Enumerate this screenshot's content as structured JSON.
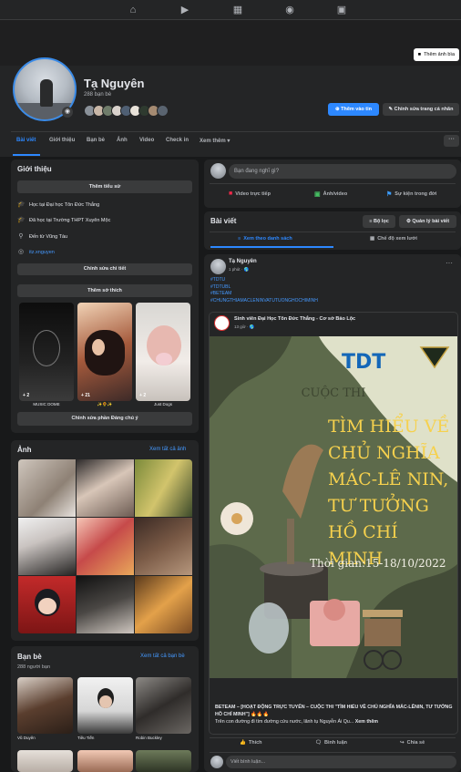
{
  "nav": {
    "icons": [
      "home-icon",
      "video-icon",
      "marketplace-icon",
      "groups-icon",
      "gaming-icon"
    ]
  },
  "cover": {
    "add_cover_label": "Thêm ảnh bìa"
  },
  "profile": {
    "name": "Tạ Nguyên",
    "friend_count": "288 bạn bè",
    "add_story_label": "Thêm vào tin",
    "edit_profile_label": "Chỉnh sửa trang cá nhân"
  },
  "tabs": [
    "Bài viết",
    "Giới thiệu",
    "Bạn bè",
    "Ảnh",
    "Video",
    "Check in",
    "Xem thêm"
  ],
  "intro": {
    "title": "Giới thiệu",
    "add_bio_label": "Thêm tiểu sử",
    "rows": [
      "Học tại Đại học Tôn Đức Thắng",
      "Đã học tại Trường THPT Xuyên Mộc",
      "Đến từ Vũng Tàu",
      "itz.xnguyen"
    ],
    "edit_details_label": "Chỉnh sửa chi tiết",
    "add_hobbies_label": "Thêm sở thích",
    "featured": [
      {
        "caption": "MUSIC DOME",
        "count": "2"
      },
      {
        "caption": "✨🌻✨",
        "count": "21"
      },
      {
        "caption": "Just Dogs",
        "count": "2"
      }
    ],
    "edit_featured_label": "Chỉnh sửa phần Đáng chú ý"
  },
  "photos": {
    "title": "Ảnh",
    "see_all_label": "Xem tất cả ảnh"
  },
  "friends": {
    "title": "Bạn bè",
    "count": "288 người bạn",
    "see_all_label": "Xem tất cả bạn bè",
    "items": [
      "Vũ Duyên",
      "Tiêu Tiến",
      "Robin Buckley"
    ]
  },
  "composer": {
    "placeholder": "Bạn đang nghĩ gì?",
    "live_label": "Video trực tiếp",
    "photo_label": "Ảnh/video",
    "event_label": "Sự kiện trong đời"
  },
  "posts_header": {
    "title": "Bài viết",
    "filter_label": "Bộ lọc",
    "manage_label": "Quản lý bài viết",
    "list_view_label": "Xem theo danh sách",
    "grid_view_label": "Chế độ xem lưới"
  },
  "post": {
    "author": "Tạ Nguyên",
    "time": "1 phút · 🌎",
    "hashtags": [
      "#TDTU",
      "#TDTUBL",
      "#BETEAM",
      "#CHUNGTHIAMACLENINVATUTUONGHOCHIMINH"
    ],
    "shared_author": "Sinh viên Đại Học Tôn Đức Thắng - Cơ sở Bảo Lộc",
    "shared_time": "13 giờ · 🌎",
    "poster": {
      "heading": "CUỘC THI",
      "title_lines": [
        "TÌM HIỂU VỀ",
        "CHỦ NGHĨA",
        "MÁC-LÊ NIN,",
        "TƯ TƯỞNG",
        "HỒ CHÍ MINH"
      ],
      "time_text": "Thời gian:15-18/10/2022"
    },
    "caption_line1": "BETEAM – [HOẠT ĐỘNG TRỰC TUYẾN – CUỘC THI \"TÌM HIỂU VỀ CHỦ NGHĨA MÁC-LÊNIN, TƯ TƯỞNG HỒ CHÍ MINH\"] 🔥🔥🔥",
    "caption_line2": "Trên con đường đi tìm đường cứu nước, lãnh tụ Nguyễn Ái Qu...",
    "see_more_label": "Xem thêm",
    "like_label": "Thích",
    "comment_label": "Bình luận",
    "share_label": "Chia sẻ",
    "comment_placeholder": "Viết bình luận..."
  },
  "colors": {
    "accent": "#2d88ff",
    "bg": "#18191a",
    "card": "#242526"
  }
}
